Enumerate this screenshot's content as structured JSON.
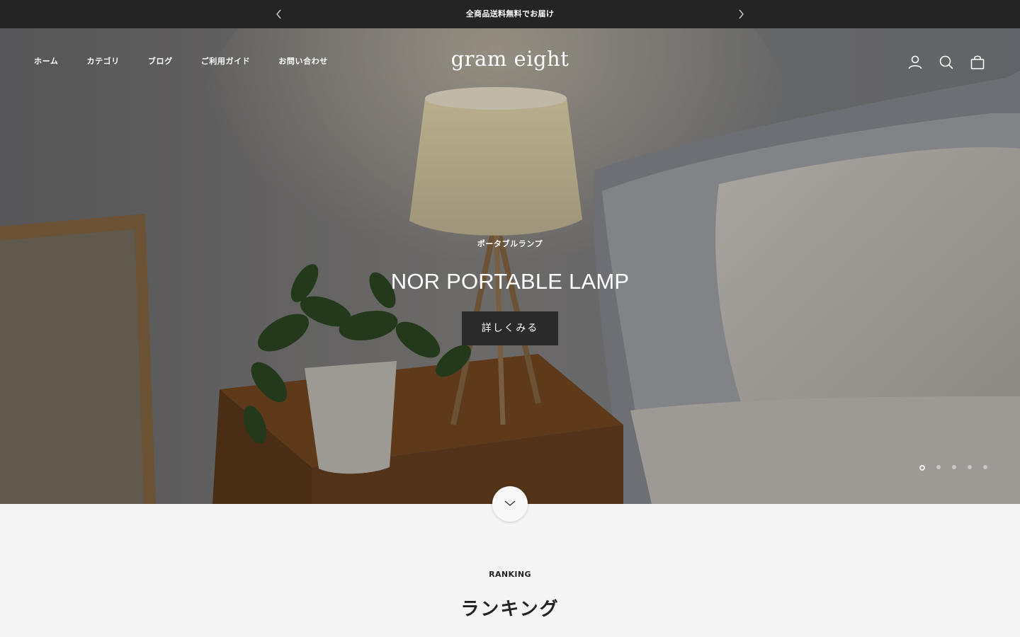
{
  "announcement": {
    "text": "全商品送料無料でお届け"
  },
  "header": {
    "logo": "gram eight",
    "nav": [
      {
        "label": "ホーム"
      },
      {
        "label": "カテゴリ"
      },
      {
        "label": "ブログ"
      },
      {
        "label": "ご利用ガイド"
      },
      {
        "label": "お問い合わせ"
      }
    ],
    "icons": [
      "account-icon",
      "search-icon",
      "cart-icon"
    ]
  },
  "hero": {
    "subtitle": "ポータブルランプ",
    "title": "NOR PORTABLE LAMP",
    "button": "詳しくみる",
    "slide_count": 5,
    "active_slide": 1
  },
  "ranking": {
    "eyebrow": "RANKING",
    "heading": "ランキング"
  },
  "colors": {
    "announcement_bg": "#242424",
    "button_bg": "#2a2a2a",
    "page_bg": "#f5f5f5"
  }
}
